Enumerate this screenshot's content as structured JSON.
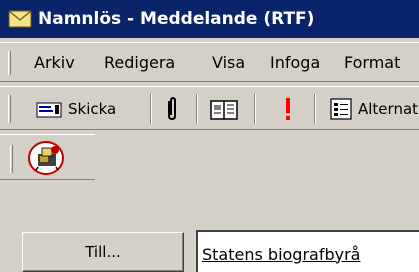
{
  "window": {
    "title": "Namnlös - Meddelande (RTF)"
  },
  "menu": [
    "Arkiv",
    "Redigera",
    "Visa",
    "Infoga",
    "Format"
  ],
  "toolbar": {
    "send_label": "Skicka",
    "options_label": "Alternativ"
  },
  "address": {
    "to_button_label": "Till...",
    "to_value": "Statens biografbyrå"
  },
  "colors": {
    "titlebar": "#0a246a",
    "priority": "#ff0000",
    "highlight_circle": "#c00000"
  },
  "icons": [
    "envelope-icon",
    "paperclip-icon",
    "address-book-icon",
    "exclamation-icon",
    "options-icon",
    "toolbar-custom-icon"
  ]
}
